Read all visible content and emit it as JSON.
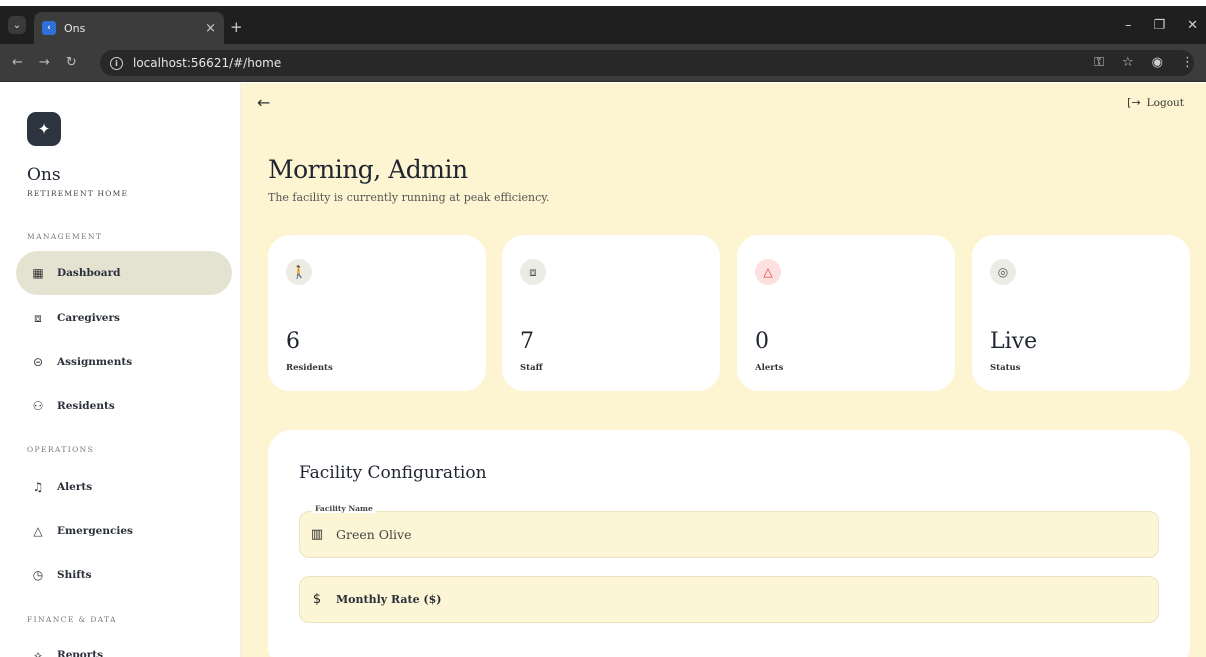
{
  "browser": {
    "tab_title": "Ons",
    "url": "localhost:56621/#/home"
  },
  "sidebar": {
    "brand_name": "Ons",
    "brand_subtitle": "RETIREMENT HOME",
    "sections": [
      {
        "title": "MANAGEMENT",
        "items": [
          {
            "label": "Dashboard",
            "icon": "dashboard-icon",
            "active": true
          },
          {
            "label": "Caregivers",
            "icon": "badge-icon"
          },
          {
            "label": "Assignments",
            "icon": "link-icon"
          },
          {
            "label": "Residents",
            "icon": "people-icon"
          }
        ]
      },
      {
        "title": "OPERATIONS",
        "items": [
          {
            "label": "Alerts",
            "icon": "bell-icon"
          },
          {
            "label": "Emergencies",
            "icon": "warning-icon"
          },
          {
            "label": "Shifts",
            "icon": "clock-icon"
          }
        ]
      },
      {
        "title": "FINANCE & DATA",
        "items": [
          {
            "label": "Reports",
            "icon": "chart-icon"
          }
        ]
      }
    ]
  },
  "header": {
    "logout_label": "Logout"
  },
  "main": {
    "greeting": "Morning, Admin",
    "subtitle": "The facility is currently running at peak efficiency.",
    "stats": [
      {
        "value": "6",
        "label": "Residents",
        "icon": "walking-person-icon"
      },
      {
        "value": "7",
        "label": "Staff",
        "icon": "id-badge-icon"
      },
      {
        "value": "0",
        "label": "Alerts",
        "icon": "warning-icon"
      },
      {
        "value": "Live",
        "label": "Status",
        "icon": "signal-icon"
      }
    ],
    "config": {
      "title": "Facility Configuration",
      "facility_name_label": "Facility Name",
      "facility_name_value": "Green Olive",
      "monthly_rate_label": "Monthly Rate ($)"
    }
  },
  "colors": {
    "main_bg": "#fdf5d2",
    "active_nav": "#e4e3d2",
    "logo_bg": "#2c3440",
    "alert_accent": "#e03535"
  }
}
